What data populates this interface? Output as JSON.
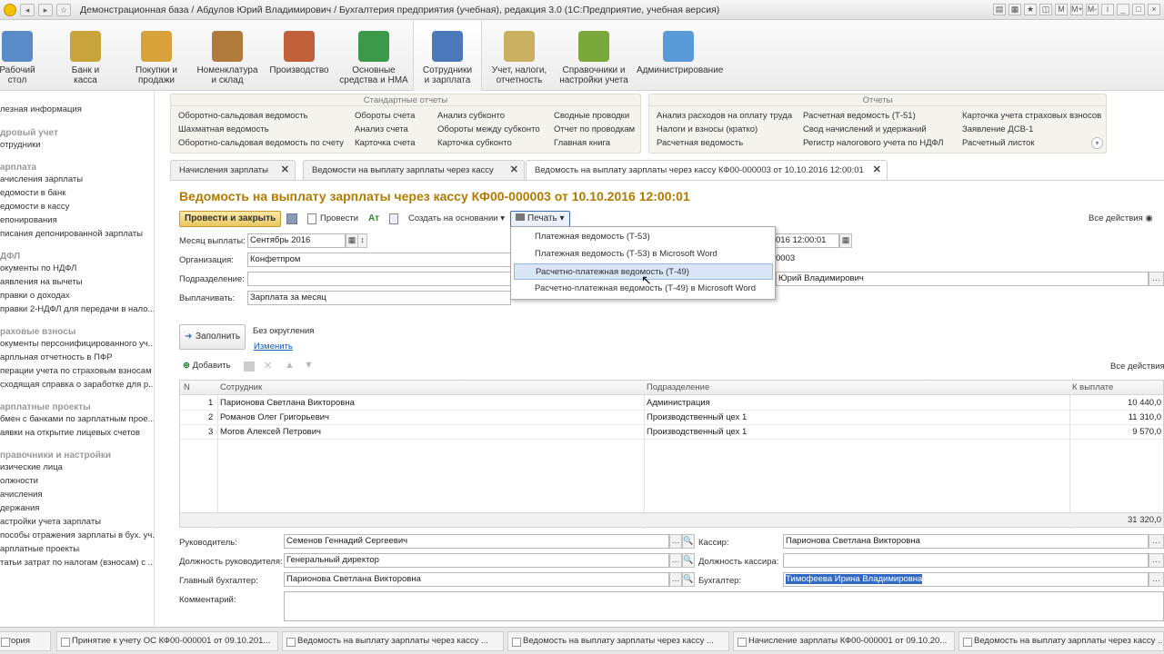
{
  "window": {
    "title": "Демонстрационная база / Абдулов Юрий Владимирович / Бухгалтерия предприятия (учебная), редакция 3.0  (1С:Предприятие, учебная версия)"
  },
  "sections": [
    {
      "label1": "Рабочий",
      "label2": "стол",
      "icon": "desktop-icon",
      "color": "#5a8bc8"
    },
    {
      "label1": "Банк и",
      "label2": "касса",
      "icon": "coins-icon",
      "color": "#c9a43a"
    },
    {
      "label1": "Покупки и",
      "label2": "продажи",
      "icon": "truck-icon",
      "color": "#d8a23a"
    },
    {
      "label1": "Номенклатура",
      "label2": "и склад",
      "icon": "warehouse-icon",
      "color": "#b07a3a"
    },
    {
      "label1": "Производство",
      "label2": "",
      "icon": "production-icon",
      "color": "#c0603a"
    },
    {
      "label1": "Основные",
      "label2": "средства и НМА",
      "icon": "assets-icon",
      "color": "#3a9a4a"
    },
    {
      "label1": "Сотрудники",
      "label2": "и зарплата",
      "icon": "employee-icon",
      "color": "#4a78b8"
    },
    {
      "label1": "Учет, налоги,",
      "label2": "отчетность",
      "icon": "reports-icon",
      "color": "#c8b060"
    },
    {
      "label1": "Справочники и",
      "label2": "настройки учета",
      "icon": "books-icon",
      "color": "#7aa83a"
    },
    {
      "label1": "Администрирование",
      "label2": "",
      "icon": "admin-icon",
      "color": "#5a9ad8"
    }
  ],
  "sidebar": {
    "items": [
      {
        "text": "лезная информация",
        "type": "item"
      },
      {
        "text": "дровый учет",
        "type": "header"
      },
      {
        "text": "отрудники",
        "type": "item"
      },
      {
        "text": "арплата",
        "type": "header"
      },
      {
        "text": "ачисления зарплаты",
        "type": "item"
      },
      {
        "text": "едомости в банк",
        "type": "item"
      },
      {
        "text": "едомости в кассу",
        "type": "item"
      },
      {
        "text": "епонирования",
        "type": "item"
      },
      {
        "text": "писания депонированной зарплаты",
        "type": "item"
      },
      {
        "text": "ДФЛ",
        "type": "header"
      },
      {
        "text": "окументы по НДФЛ",
        "type": "item"
      },
      {
        "text": "аявления на вычеты",
        "type": "item"
      },
      {
        "text": "правки о доходах",
        "type": "item"
      },
      {
        "text": "правки 2-НДФЛ для передачи в нало...",
        "type": "item"
      },
      {
        "text": "раховые взносы",
        "type": "header"
      },
      {
        "text": "окументы персонифицированного уч...",
        "type": "item"
      },
      {
        "text": "арпльная отчетность в ПФР",
        "type": "item"
      },
      {
        "text": "перации учета по страховым взносам",
        "type": "item"
      },
      {
        "text": "сходящая справка о заработке для р...",
        "type": "item"
      },
      {
        "text": "арплатные проекты",
        "type": "header"
      },
      {
        "text": "бмен с банками по зарплатным прое...",
        "type": "item"
      },
      {
        "text": "аявки на открытие лицевых счетов",
        "type": "item"
      },
      {
        "text": "правочники и настройки",
        "type": "header"
      },
      {
        "text": "изические лица",
        "type": "item"
      },
      {
        "text": "олжности",
        "type": "item"
      },
      {
        "text": "ачисления",
        "type": "item"
      },
      {
        "text": "держания",
        "type": "item"
      },
      {
        "text": "астройки учета зарплаты",
        "type": "item"
      },
      {
        "text": "пособы отражения зарплаты в бух. уч...",
        "type": "item"
      },
      {
        "text": "арплатные проекты",
        "type": "item"
      },
      {
        "text": "татьи затрат по налогам (взносам) с ...",
        "type": "item"
      }
    ]
  },
  "std_reports": {
    "title": "Стандартные отчеты",
    "col1": [
      "Оборотно-сальдовая ведомость",
      "Шахматная ведомость",
      "Оборотно-сальдовая ведомость по счету"
    ],
    "col2": [
      "Обороты счета",
      "Анализ счета",
      "Карточка счета"
    ],
    "col3": [
      "Анализ субконто",
      "Обороты между субконто",
      "Карточка субконто"
    ],
    "col4": [
      "Сводные проводки",
      "Отчет по проводкам",
      "Главная книга"
    ]
  },
  "reports": {
    "title": "Отчеты",
    "col1": [
      "Анализ расходов на оплату труда",
      "Налоги и взносы (кратко)",
      "Расчетная ведомость"
    ],
    "col2": [
      "Расчетная ведомость (Т-51)",
      "Свод начислений и удержаний",
      "Регистр налогового учета по НДФЛ"
    ],
    "col3": [
      "Карточка учета страховых взносов",
      "Заявление ДСВ-1",
      "Расчетный листок"
    ]
  },
  "tabs": [
    {
      "label": "Начисления зарплаты"
    },
    {
      "label": "Ведомости на выплату зарплаты через кассу"
    },
    {
      "label": "Ведомость на выплату зарплаты через кассу КФ00-000003 от 10.10.2016 12:00:01"
    }
  ],
  "doc": {
    "title": "Ведомость на выплату зарплаты через кассу КФ00-000003 от 10.10.2016 12:00:01",
    "toolbar": {
      "post_close": "Провести и закрыть",
      "post": "Провести",
      "create_basis": "Создать на основании",
      "print": "Печать",
      "all_actions": "Все действия"
    },
    "fields": {
      "month_label": "Месяц выплаты:",
      "month_value": "Сентябрь 2016",
      "org_label": "Организация:",
      "org_value": "Конфетпром",
      "dept_label": "Подразделение:",
      "dept_value": "",
      "pay_label": "Выплачивать:",
      "pay_value": "Зарплата за месяц",
      "date_value": "016 12:00:01",
      "number_value": "0003",
      "resp_value": "Юрий Владимирович"
    },
    "fill_button": "Заполнить",
    "rounding": "Без округления",
    "change_link": "Изменить",
    "add_button": "Добавить",
    "table_all_actions": "Все действия",
    "table": {
      "headers": [
        "N",
        "Сотрудник",
        "Подразделение",
        "К выплате"
      ],
      "rows": [
        {
          "n": "1",
          "employee": "Парионова Светлана Викторовна",
          "dept": "Администрация",
          "amount": "10 440,0"
        },
        {
          "n": "2",
          "employee": "Романов Олег Григорьевич",
          "dept": "Производственный цех 1",
          "amount": "11 310,0"
        },
        {
          "n": "3",
          "employee": "Могов Алексей Петрович",
          "dept": "Производственный цех 1",
          "amount": "9 570,0"
        }
      ],
      "total": "31 320,0"
    },
    "bottom": {
      "head_label": "Руководитель:",
      "head_value": "Семенов Геннадий Сергеевич",
      "head_pos_label": "Должность руководителя:",
      "head_pos_value": "Генеральный директор",
      "chief_acc_label": "Главный бухгалтер:",
      "chief_acc_value": "Парионова Светлана Викторовна",
      "comment_label": "Комментарий:",
      "comment_value": "",
      "cashier_label": "Кассир:",
      "cashier_value": "Парионова Светлана Викторовна",
      "cashier_pos_label": "Должность кассира:",
      "cashier_pos_value": "",
      "acc_label": "Бухгалтер:",
      "acc_value": "Тимофеева Ирина Владимировна"
    }
  },
  "print_menu": {
    "items": [
      "Платежная ведомость (Т-53)",
      "Платежная ведомость (Т-53) в Microsoft Word",
      "Расчетно-платежная ведомость (Т-49)",
      "Расчетно-платежная ведомость (Т-49) в Microsoft Word"
    ],
    "highlighted": 2
  },
  "taskbar": [
    "стория",
    "Принятие к учету ОС КФ00-000001 от 09.10.201...",
    "Ведомость на выплату зарплаты через кассу ...",
    "Ведомость на выплату зарплаты через кассу ...",
    "Начисление зарплаты КФ00-000001 от 09.10.20...",
    "Ведомость на выплату зарплаты через кассу ..."
  ]
}
